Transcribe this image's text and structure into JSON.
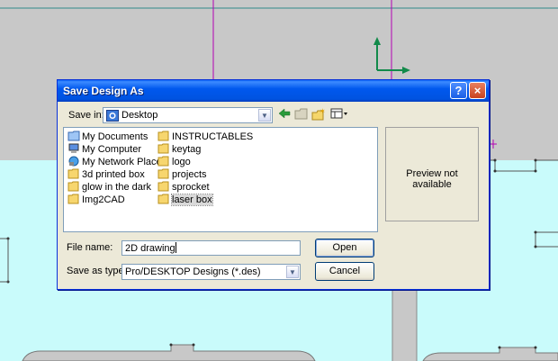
{
  "dialog": {
    "title": "Save Design As",
    "help_glyph": "?",
    "close_glyph": "×"
  },
  "save_in": {
    "label": "Save in:",
    "value": "Desktop"
  },
  "toolbar": {
    "back_icon": "back-arrow-icon",
    "up_icon": "up-folder-icon",
    "new_folder_icon": "new-folder-icon",
    "views_icon": "views-menu-icon"
  },
  "files": [
    {
      "name": "My Documents",
      "icon": "my-documents-icon"
    },
    {
      "name": "My Computer",
      "icon": "my-computer-icon"
    },
    {
      "name": "My Network Places",
      "icon": "network-places-icon"
    },
    {
      "name": "3d printed box",
      "icon": "folder-icon"
    },
    {
      "name": "glow in the dark",
      "icon": "folder-icon"
    },
    {
      "name": "Img2CAD",
      "icon": "folder-icon"
    },
    {
      "name": "INSTRUCTABLES",
      "icon": "folder-icon"
    },
    {
      "name": "keytag",
      "icon": "folder-icon"
    },
    {
      "name": "logo",
      "icon": "folder-icon"
    },
    {
      "name": "projects",
      "icon": "folder-icon"
    },
    {
      "name": "sprocket",
      "icon": "folder-icon"
    },
    {
      "name": "laser box",
      "icon": "folder-icon",
      "selected": true
    }
  ],
  "preview": {
    "text": "Preview not available"
  },
  "file_name": {
    "label": "File name:",
    "value": "2D drawing"
  },
  "save_as_type": {
    "label": "Save as type:",
    "value": "Pro/DESKTOP Designs (*.des)"
  },
  "buttons": {
    "open": "Open",
    "cancel": "Cancel"
  },
  "colors": {
    "cad_grey": "#c8c8c8",
    "cad_cyan": "#c9fbfb",
    "axis_green": "#128a4a",
    "line_magenta": "#b400b4",
    "titlebar_blue": "#0058ee"
  }
}
